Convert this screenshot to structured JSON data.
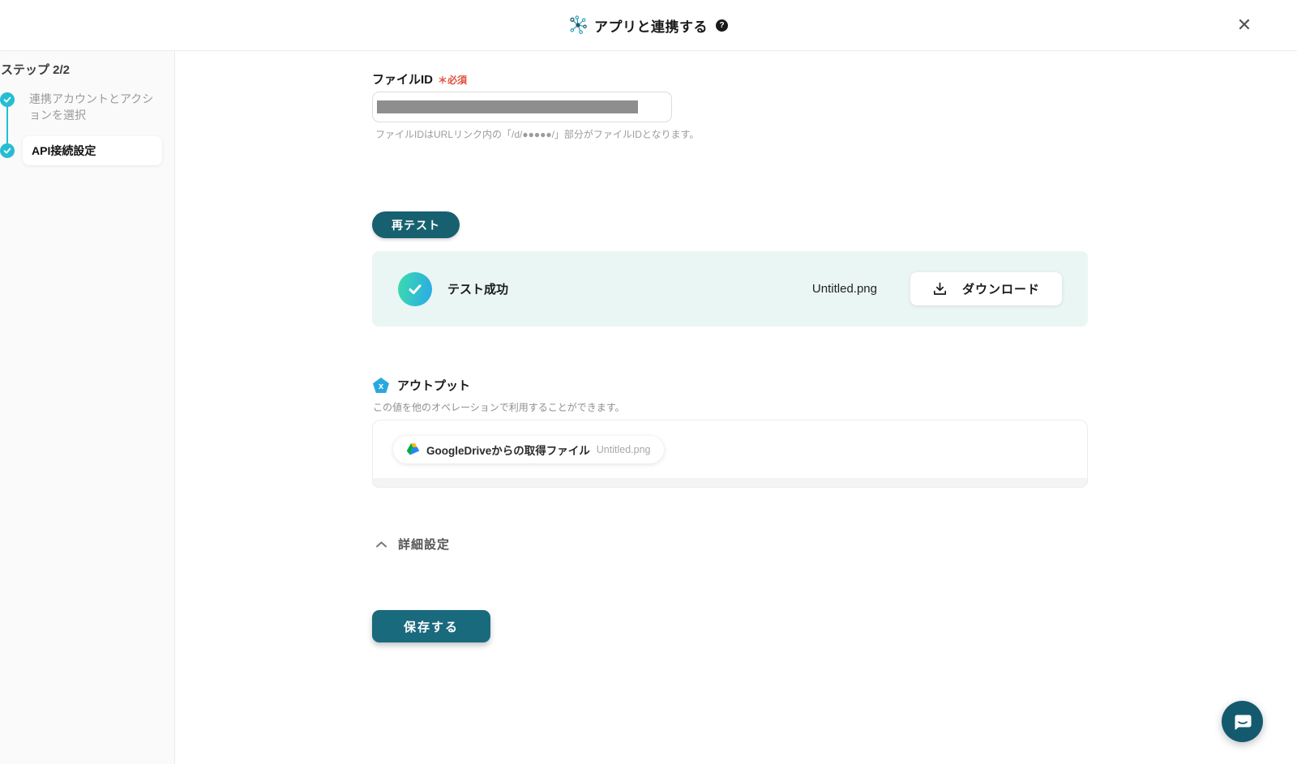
{
  "header": {
    "title": "アプリと連携する",
    "help_icon": "?",
    "close_icon": "✕"
  },
  "sidebar": {
    "step_counter": "ステップ 2/2",
    "steps": [
      {
        "label": "連携アカウントとアクションを選択",
        "state": "done"
      },
      {
        "label": "API接続設定",
        "state": "active"
      }
    ]
  },
  "form": {
    "file_id": {
      "label": "ファイルID",
      "required_badge": "＊必須",
      "value_redacted": true,
      "helper": "ファイルIDはURLリンク内の「/d/●●●●●/」部分がファイルIDとなります。"
    },
    "retest_button": "再テスト",
    "test_result": {
      "status": "テスト成功",
      "file_name": "Untitled.png",
      "download_button": "ダウンロード"
    }
  },
  "output": {
    "title": "アウトプット",
    "icon_glyph": "x",
    "description": "この値を他のオペレーションで利用することができます。",
    "chip": {
      "app": "GoogleDrive",
      "label": "GoogleDriveからの取得ファイル",
      "value": "Untitled.png"
    }
  },
  "advanced_settings": {
    "label": "詳細設定"
  },
  "save_button": "保存する",
  "colors": {
    "primary_teal": "#17606f",
    "accent_cyan": "#26bdd2",
    "output_blue": "#29a8e0",
    "required_red": "#e0503c",
    "success_panel_bg": "#eaf6f3",
    "success_gradient": [
      "#3cdcab",
      "#29a9e9"
    ]
  }
}
